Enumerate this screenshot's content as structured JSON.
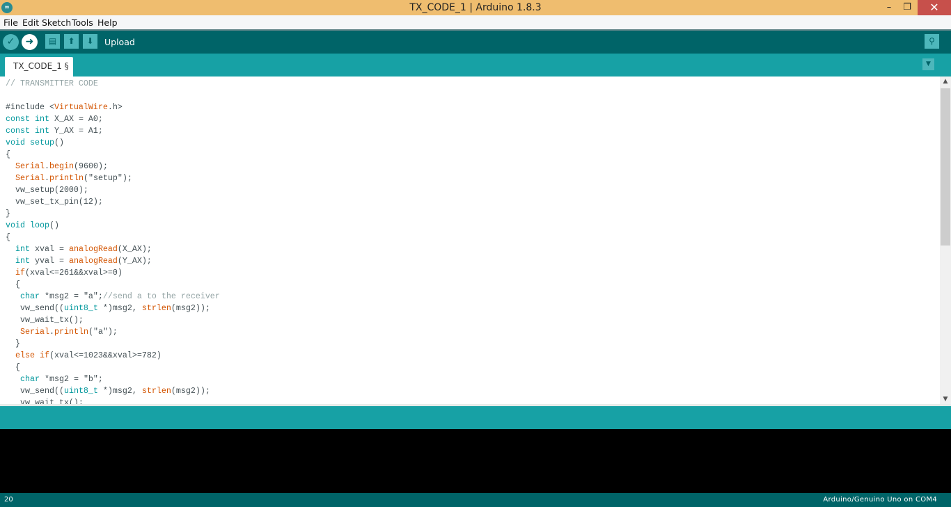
{
  "window": {
    "title": "TX_CODE_1 | Arduino 1.8.3",
    "minimize": "–",
    "restore": "❐",
    "close": "✕"
  },
  "menu": [
    "File",
    "Edit",
    "Sketch",
    "Tools",
    "Help"
  ],
  "toolbar": {
    "verify_icon": "✓",
    "upload_icon": "➜",
    "new_icon": "▤",
    "open_icon": "⬆",
    "save_icon": "⬇",
    "hover_label": "Upload",
    "serial_monitor_icon": "⚲"
  },
  "tabs": [
    {
      "label": "TX_CODE_1 §"
    }
  ],
  "tab_menu_icon": "▼",
  "colors": {
    "title_bar": "#efbd6f",
    "toolbar": "#006468",
    "tab_bar": "#17a1a5",
    "keyword": "#00979c",
    "function": "#d35400",
    "comment": "#95a5a6"
  },
  "code": [
    [
      [
        "// TRANSMITTER CODE",
        "cm"
      ]
    ],
    [],
    [
      [
        "#include <",
        ""
      ],
      [
        "VirtualWire",
        "fn"
      ],
      [
        ".h>",
        ""
      ]
    ],
    [
      [
        "const int",
        "kw"
      ],
      [
        " X_AX = A0;",
        ""
      ]
    ],
    [
      [
        "const int",
        "kw"
      ],
      [
        " Y_AX = A1;",
        ""
      ]
    ],
    [
      [
        "void setup",
        "kw"
      ],
      [
        "()",
        ""
      ]
    ],
    [
      [
        "{",
        ""
      ]
    ],
    [
      [
        "  ",
        ""
      ],
      [
        "Serial",
        "fn"
      ],
      [
        ".",
        ""
      ],
      [
        "begin",
        "fn"
      ],
      [
        "(9600);",
        ""
      ]
    ],
    [
      [
        "  ",
        ""
      ],
      [
        "Serial",
        "fn"
      ],
      [
        ".",
        ""
      ],
      [
        "println",
        "fn"
      ],
      [
        "(\"setup\");",
        ""
      ]
    ],
    [
      [
        "  vw_setup(2000);",
        ""
      ]
    ],
    [
      [
        "  vw_set_tx_pin(12);",
        ""
      ]
    ],
    [
      [
        "}",
        ""
      ]
    ],
    [
      [
        "void loop",
        "kw"
      ],
      [
        "()",
        ""
      ]
    ],
    [
      [
        "{",
        ""
      ]
    ],
    [
      [
        "  ",
        ""
      ],
      [
        "int",
        "kw"
      ],
      [
        " xval = ",
        ""
      ],
      [
        "analogRead",
        "fn"
      ],
      [
        "(X_AX);",
        ""
      ]
    ],
    [
      [
        "  ",
        ""
      ],
      [
        "int",
        "kw"
      ],
      [
        " yval = ",
        ""
      ],
      [
        "analogRead",
        "fn"
      ],
      [
        "(Y_AX);",
        ""
      ]
    ],
    [
      [
        "  ",
        ""
      ],
      [
        "if",
        "fn"
      ],
      [
        "(xval<=261&&xval>=0)",
        ""
      ]
    ],
    [
      [
        "  {",
        ""
      ]
    ],
    [
      [
        "   ",
        ""
      ],
      [
        "char",
        "kw"
      ],
      [
        " *msg2 = \"a\";",
        ""
      ],
      [
        "//send a to the receiver",
        "cm"
      ]
    ],
    [
      [
        "   vw_send((",
        ""
      ],
      [
        "uint8_t",
        "kw"
      ],
      [
        " *)msg2, ",
        ""
      ],
      [
        "strlen",
        "fn"
      ],
      [
        "(msg2));",
        ""
      ]
    ],
    [
      [
        "   vw_wait_tx();",
        ""
      ]
    ],
    [
      [
        "   ",
        ""
      ],
      [
        "Serial",
        "fn"
      ],
      [
        ".",
        ""
      ],
      [
        "println",
        "fn"
      ],
      [
        "(\"a\");",
        ""
      ]
    ],
    [
      [
        "  }",
        ""
      ]
    ],
    [
      [
        "  ",
        ""
      ],
      [
        "else",
        "fn"
      ],
      [
        " ",
        ""
      ],
      [
        "if",
        "fn"
      ],
      [
        "(xval<=1023&&xval>=782)",
        ""
      ]
    ],
    [
      [
        "  {",
        ""
      ]
    ],
    [
      [
        "   ",
        ""
      ],
      [
        "char",
        "kw"
      ],
      [
        " *msg2 = \"b\";",
        ""
      ]
    ],
    [
      [
        "   vw_send((",
        ""
      ],
      [
        "uint8_t",
        "kw"
      ],
      [
        " *)msg2, ",
        ""
      ],
      [
        "strlen",
        "fn"
      ],
      [
        "(msg2));",
        ""
      ]
    ],
    [
      [
        "   vw_wait_tx();",
        ""
      ]
    ]
  ],
  "status": {
    "line_number": "20",
    "board": "Arduino/Genuino Uno on COM4"
  }
}
